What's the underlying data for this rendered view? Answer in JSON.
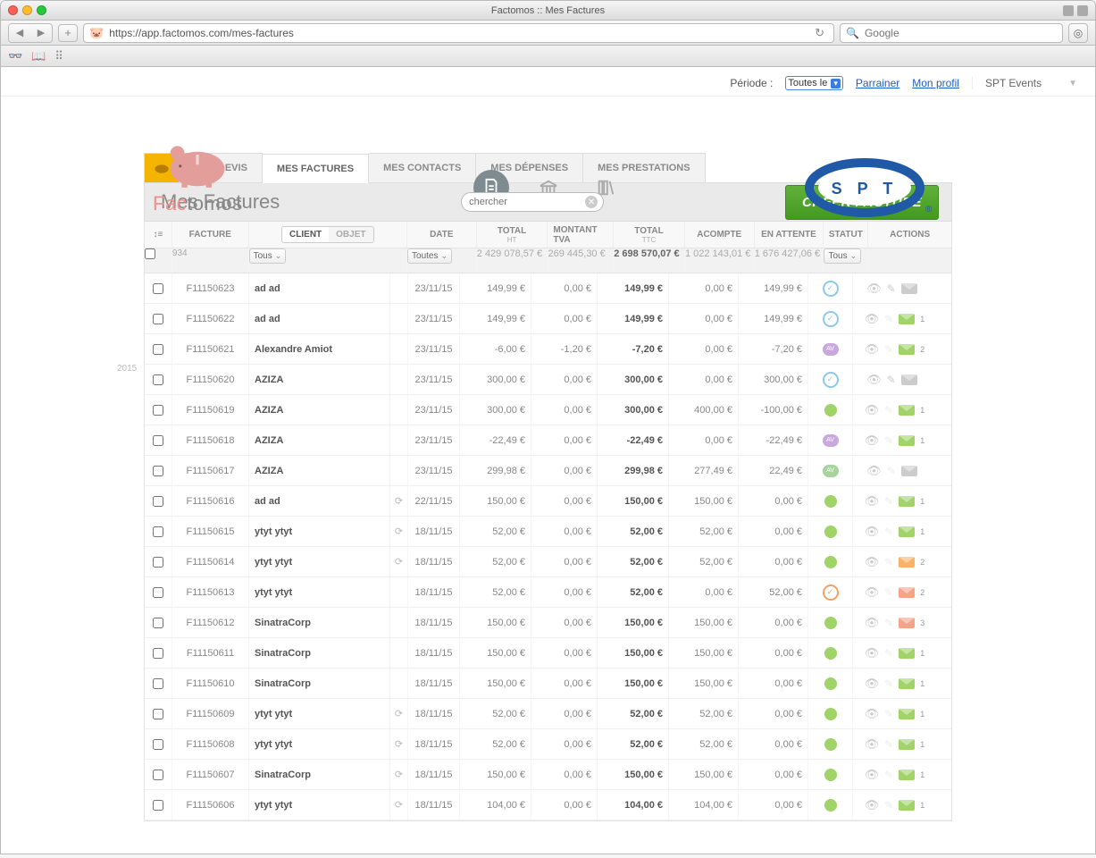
{
  "window_title": "Factomos :: Mes Factures",
  "url": "https://app.factomos.com/mes-factures",
  "browser_search_placeholder": "Google",
  "topbar": {
    "period_label": "Période :",
    "period_value": "Toutes le",
    "link_parrainer": "Parrainer",
    "link_profil": "Mon profil",
    "company": "SPT Events"
  },
  "brand": {
    "word1": "Fac",
    "word2": "tomos"
  },
  "tabs": {
    "devis": "MES DEVIS",
    "factures": "MES FACTURES",
    "contacts": "MES CONTACTS",
    "depenses": "MES DÉPENSES",
    "prestations": "MES PRESTATIONS"
  },
  "page_title": "Mes Factures",
  "search_placeholder": "chercher",
  "create_btn": "CRÉER FACTURE",
  "year_label": "2015",
  "columns": {
    "facture": "FACTURE",
    "client": "CLIENT",
    "objet": "OBJET",
    "date": "DATE",
    "total_ht": "TOTAL",
    "ht_sub": "HT",
    "tva": "MONTANT TVA",
    "total_ttc": "TOTAL",
    "ttc_sub": "TTC",
    "acompte": "ACOMPTE",
    "attente": "EN ATTENTE",
    "statut": "STATUT",
    "actions": "ACTIONS"
  },
  "filters": {
    "count": "934",
    "tous": "Tous",
    "toutes": "Toutes",
    "total_ht": "2 429 078,57 €",
    "total_tva": "269 445,30 €",
    "total_ttc": "2 698 570,07 €",
    "total_acompte": "1 022 143,01 €",
    "total_attente": "1 676 427,06 €"
  },
  "rows": [
    {
      "facture": "F11150623",
      "client": "ad ad",
      "refresh": false,
      "date": "23/11/15",
      "ht": "149,99 €",
      "tva": "0,00 €",
      "ttc": "149,99 €",
      "acompte": "0,00 €",
      "attente": "149,99 €",
      "status": "ring-blue",
      "mail": "gray",
      "mailCount": "",
      "edit": true
    },
    {
      "facture": "F11150622",
      "client": "ad ad",
      "refresh": false,
      "date": "23/11/15",
      "ht": "149,99 €",
      "tva": "0,00 €",
      "ttc": "149,99 €",
      "acompte": "0,00 €",
      "attente": "149,99 €",
      "status": "ring-blue",
      "mail": "green",
      "mailCount": "1",
      "edit": false
    },
    {
      "facture": "F11150621",
      "client": "Alexandre Amiot",
      "refresh": false,
      "date": "23/11/15",
      "ht": "-6,00 €",
      "tva": "-1,20 €",
      "ttc": "-7,20 €",
      "acompte": "0,00 €",
      "attente": "-7,20 €",
      "status": "pill-purple",
      "mail": "green",
      "mailCount": "2",
      "edit": false
    },
    {
      "facture": "F11150620",
      "client": "AZIZA",
      "refresh": false,
      "date": "23/11/15",
      "ht": "300,00 €",
      "tva": "0,00 €",
      "ttc": "300,00 €",
      "acompte": "0,00 €",
      "attente": "300,00 €",
      "status": "ring-blue",
      "mail": "gray",
      "mailCount": "",
      "edit": true
    },
    {
      "facture": "F11150619",
      "client": "AZIZA",
      "refresh": false,
      "date": "23/11/15",
      "ht": "300,00 €",
      "tva": "0,00 €",
      "ttc": "300,00 €",
      "acompte": "400,00 €",
      "attente": "-100,00 €",
      "status": "dot-green",
      "mail": "green",
      "mailCount": "1",
      "edit": false
    },
    {
      "facture": "F11150618",
      "client": "AZIZA",
      "refresh": false,
      "date": "23/11/15",
      "ht": "-22,49 €",
      "tva": "0,00 €",
      "ttc": "-22,49 €",
      "acompte": "0,00 €",
      "attente": "-22,49 €",
      "status": "pill-purple",
      "mail": "green",
      "mailCount": "1",
      "edit": false
    },
    {
      "facture": "F11150617",
      "client": "AZIZA",
      "refresh": false,
      "date": "23/11/15",
      "ht": "299,98 €",
      "tva": "0,00 €",
      "ttc": "299,98 €",
      "acompte": "277,49 €",
      "attente": "22,49 €",
      "status": "pill-green",
      "mail": "gray",
      "mailCount": "",
      "edit": false
    },
    {
      "facture": "F11150616",
      "client": "ad ad",
      "refresh": true,
      "date": "22/11/15",
      "ht": "150,00 €",
      "tva": "0,00 €",
      "ttc": "150,00 €",
      "acompte": "150,00 €",
      "attente": "0,00 €",
      "status": "dot-green",
      "mail": "green",
      "mailCount": "1",
      "edit": false
    },
    {
      "facture": "F11150615",
      "client": "ytyt ytyt",
      "refresh": true,
      "date": "18/11/15",
      "ht": "52,00 €",
      "tva": "0,00 €",
      "ttc": "52,00 €",
      "acompte": "52,00 €",
      "attente": "0,00 €",
      "status": "dot-green",
      "mail": "green",
      "mailCount": "1",
      "edit": false
    },
    {
      "facture": "F11150614",
      "client": "ytyt ytyt",
      "refresh": true,
      "date": "18/11/15",
      "ht": "52,00 €",
      "tva": "0,00 €",
      "ttc": "52,00 €",
      "acompte": "52,00 €",
      "attente": "0,00 €",
      "status": "dot-green",
      "mail": "orange",
      "mailCount": "2",
      "edit": false
    },
    {
      "facture": "F11150613",
      "client": "ytyt ytyt",
      "refresh": false,
      "date": "18/11/15",
      "ht": "52,00 €",
      "tva": "0,00 €",
      "ttc": "52,00 €",
      "acompte": "0,00 €",
      "attente": "52,00 €",
      "status": "ring-orange",
      "mail": "salmon",
      "mailCount": "2",
      "edit": false
    },
    {
      "facture": "F11150612",
      "client": "SinatraCorp",
      "refresh": false,
      "date": "18/11/15",
      "ht": "150,00 €",
      "tva": "0,00 €",
      "ttc": "150,00 €",
      "acompte": "150,00 €",
      "attente": "0,00 €",
      "status": "dot-green",
      "mail": "salmon",
      "mailCount": "3",
      "edit": false
    },
    {
      "facture": "F11150611",
      "client": "SinatraCorp",
      "refresh": false,
      "date": "18/11/15",
      "ht": "150,00 €",
      "tva": "0,00 €",
      "ttc": "150,00 €",
      "acompte": "150,00 €",
      "attente": "0,00 €",
      "status": "dot-green",
      "mail": "green",
      "mailCount": "1",
      "edit": false
    },
    {
      "facture": "F11150610",
      "client": "SinatraCorp",
      "refresh": false,
      "date": "18/11/15",
      "ht": "150,00 €",
      "tva": "0,00 €",
      "ttc": "150,00 €",
      "acompte": "150,00 €",
      "attente": "0,00 €",
      "status": "dot-green",
      "mail": "green",
      "mailCount": "1",
      "edit": false
    },
    {
      "facture": "F11150609",
      "client": "ytyt ytyt",
      "refresh": true,
      "date": "18/11/15",
      "ht": "52,00 €",
      "tva": "0,00 €",
      "ttc": "52,00 €",
      "acompte": "52,00 €",
      "attente": "0,00 €",
      "status": "dot-green",
      "mail": "green",
      "mailCount": "1",
      "edit": false
    },
    {
      "facture": "F11150608",
      "client": "ytyt ytyt",
      "refresh": true,
      "date": "18/11/15",
      "ht": "52,00 €",
      "tva": "0,00 €",
      "ttc": "52,00 €",
      "acompte": "52,00 €",
      "attente": "0,00 €",
      "status": "dot-green",
      "mail": "green",
      "mailCount": "1",
      "edit": false
    },
    {
      "facture": "F11150607",
      "client": "SinatraCorp",
      "refresh": true,
      "date": "18/11/15",
      "ht": "150,00 €",
      "tva": "0,00 €",
      "ttc": "150,00 €",
      "acompte": "150,00 €",
      "attente": "0,00 €",
      "status": "dot-green",
      "mail": "green",
      "mailCount": "1",
      "edit": false
    },
    {
      "facture": "F11150606",
      "client": "ytyt ytyt",
      "refresh": true,
      "date": "18/11/15",
      "ht": "104,00 €",
      "tva": "0,00 €",
      "ttc": "104,00 €",
      "acompte": "104,00 €",
      "attente": "0,00 €",
      "status": "dot-green",
      "mail": "green",
      "mailCount": "1",
      "edit": false
    }
  ]
}
